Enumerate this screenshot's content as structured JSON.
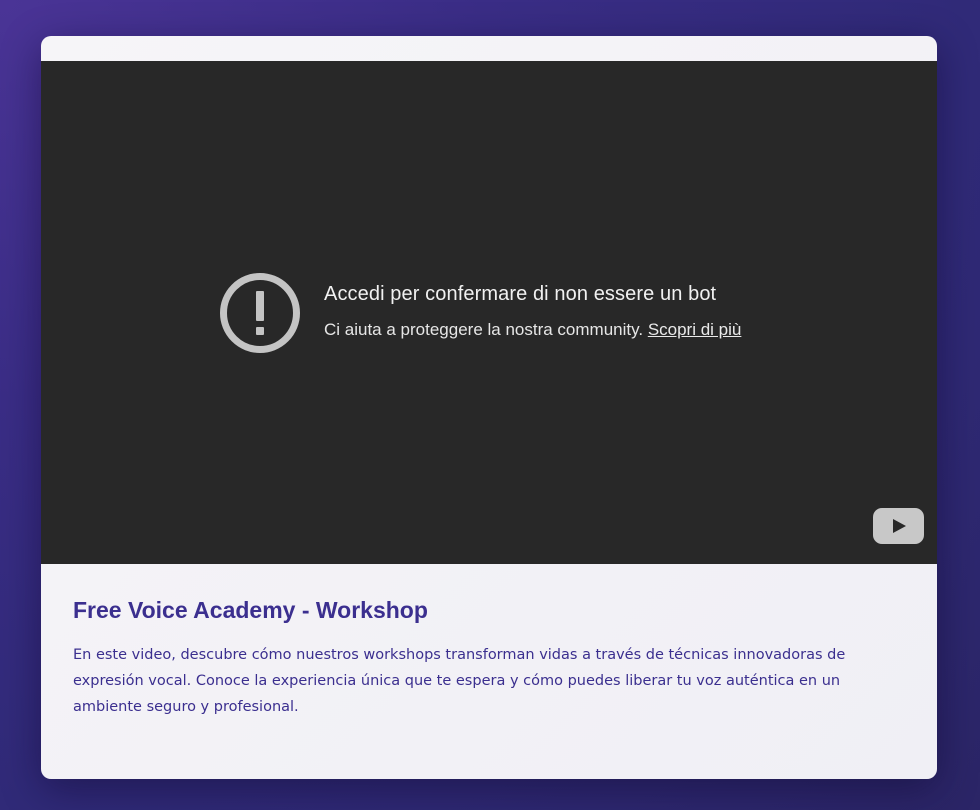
{
  "player": {
    "error_title": "Accedi per confermare di non essere un bot",
    "error_message": "Ci aiuta a proteggere la nostra community.",
    "learn_more_link": "Scopri di più",
    "error_icon": "exclamation-circle-icon",
    "logo_icon": "youtube-logo-icon"
  },
  "video_info": {
    "title": "Free Voice Academy - Workshop",
    "description": "En este video, descubre cómo nuestros workshops transforman vidas a través de técnicas innovadoras de expresión vocal. Conoce la experiencia única que te espera y cómo puedes liberar tu voz auténtica en un ambiente seguro y profesional."
  },
  "colors": {
    "background": "#302a78",
    "card": "#f3f2f7",
    "player": "#282828",
    "accent_text": "#3b2f8f"
  }
}
